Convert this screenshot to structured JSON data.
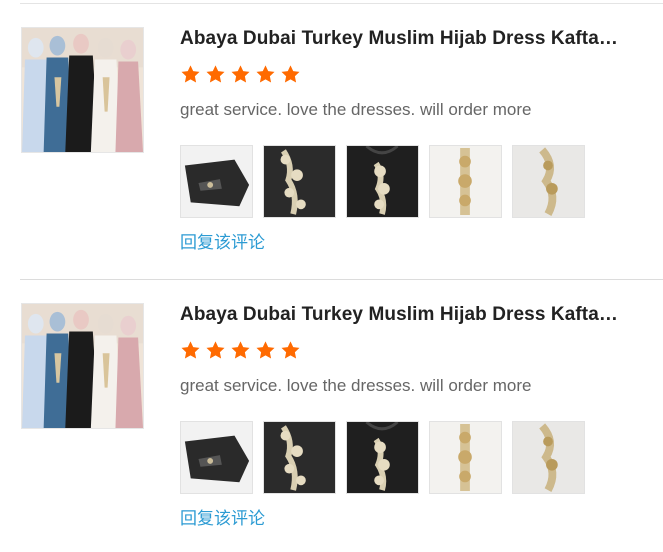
{
  "reviews": [
    {
      "product_title": "Abaya Dubai Turkey Muslim Hijab Dress Kaftan...",
      "rating": 5,
      "max_rating": 5,
      "comment": "great service. love the dresses. will order more",
      "photos": [
        "black-dress-flat",
        "black-embroidery-closeup",
        "black-dress-neckline",
        "white-embroidery-closeup",
        "white-dress-embroidery"
      ],
      "reply_label": "回复该评论"
    },
    {
      "product_title": "Abaya Dubai Turkey Muslim Hijab Dress Kaftan...",
      "rating": 5,
      "max_rating": 5,
      "comment": "great service. love the dresses. will order more",
      "photos": [
        "black-dress-flat",
        "black-embroidery-closeup",
        "black-dress-neckline",
        "white-embroidery-closeup",
        "white-dress-embroidery"
      ],
      "reply_label": "回复该评论"
    }
  ],
  "colors": {
    "star": "#ff6a00",
    "link": "#2c9bd3",
    "title": "#222222",
    "comment": "#666666"
  }
}
